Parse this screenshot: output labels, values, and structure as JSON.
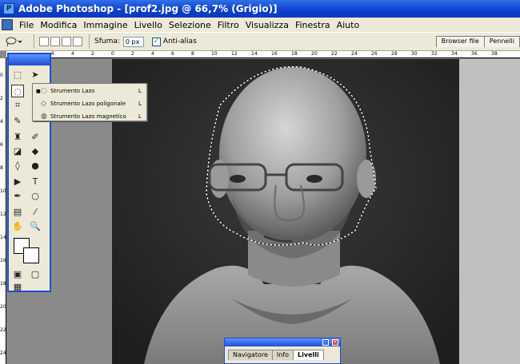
{
  "window": {
    "title": "Adobe Photoshop - [prof2.jpg @ 66,7% (Grigio)]"
  },
  "menu": [
    "File",
    "Modifica",
    "Immagine",
    "Livello",
    "Selezione",
    "Filtro",
    "Visualizza",
    "Finestra",
    "Aiuto"
  ],
  "options": {
    "feather_label": "Sfuma:",
    "feather_value": "0 px",
    "antialias_label": "Anti-alias",
    "antialias_checked": true,
    "right_tabs": [
      "Browser file",
      "Pennelli"
    ]
  },
  "ruler_top": [
    "6",
    "4",
    "2",
    "0",
    "2",
    "4",
    "6",
    "8",
    "10",
    "12",
    "14",
    "16",
    "18",
    "20",
    "22",
    "24",
    "26",
    "28",
    "30",
    "32",
    "34",
    "36",
    "38"
  ],
  "ruler_left": [
    "0",
    "2",
    "4",
    "6",
    "8",
    "10",
    "12",
    "14",
    "16",
    "18",
    "20",
    "22",
    "24"
  ],
  "flyout": {
    "items": [
      {
        "name": "Strumento Lazo",
        "key": "L",
        "selected": true
      },
      {
        "name": "Strumento Lazo poligonale",
        "key": "L",
        "selected": false
      },
      {
        "name": "Strumento Lazo magnetico",
        "key": "L",
        "selected": false
      }
    ]
  },
  "palette": {
    "tabs": [
      "Navigatore",
      "Info",
      "Livelli"
    ],
    "active_tab": "Livelli"
  }
}
